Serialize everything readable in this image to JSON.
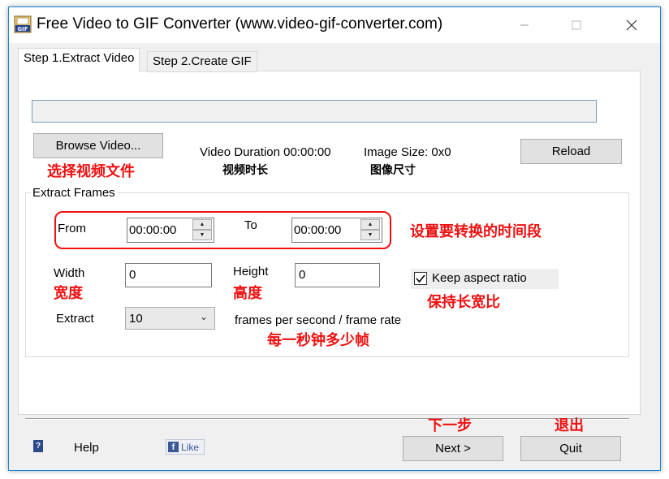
{
  "window": {
    "title": "Free Video to GIF Converter (www.video-gif-converter.com)"
  },
  "tabs": [
    {
      "label": "Step 1.Extract Video",
      "active": true
    },
    {
      "label": "Step 2.Create GIF",
      "active": false
    }
  ],
  "extract": {
    "path_value": "",
    "browse_label": "Browse Video...",
    "browse_note": "选择视频文件",
    "duration_label": "Video Duration 00:00:00",
    "duration_note": "视频时长",
    "image_size_label": "Image Size: 0x0",
    "image_size_note": "图像尺寸",
    "reload_label": "Reload"
  },
  "frames": {
    "group_title": "Extract Frames",
    "from_label": "From",
    "from_value": "00:00:00",
    "to_label": "To",
    "to_value": "00:00:00",
    "time_note": "设置要转换的时间段",
    "width_label": "Width",
    "width_note": "宽度",
    "width_value": "0",
    "height_label": "Height",
    "height_note": "高度",
    "height_value": "0",
    "keep_aspect_label": "Keep aspect ratio",
    "keep_aspect_checked": true,
    "keep_aspect_note": "保持长宽比",
    "extract_label": "Extract",
    "extract_value": "10",
    "fps_label": "frames per second / frame rate",
    "fps_note": "每一秒钟多少帧"
  },
  "footer": {
    "help_label": "Help",
    "like_label": "Like",
    "next_label": "Next >",
    "next_note": "下一步",
    "quit_label": "Quit",
    "quit_note": "退出"
  },
  "icons": {
    "app": "gif-app-icon",
    "help": "help-book-icon",
    "facebook": "facebook-icon"
  },
  "colors": {
    "accent_border": "#1883d7",
    "annotation": "#ee1111"
  }
}
